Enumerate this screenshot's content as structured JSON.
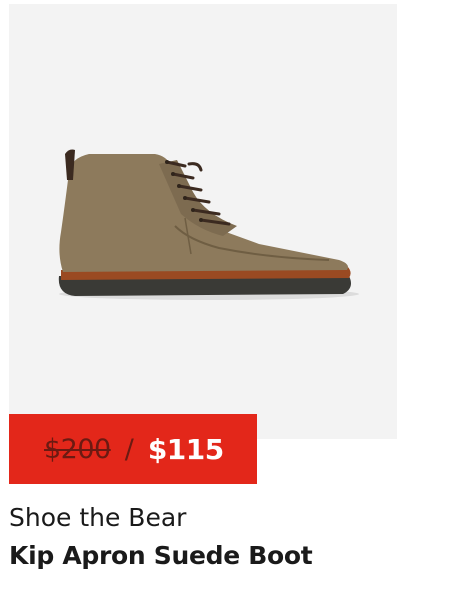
{
  "product": {
    "image_alt": "Kip Apron Suede Boot",
    "price": {
      "original": "$200",
      "separator": "/",
      "sale": "$115",
      "badge_color": "#e3271a"
    },
    "brand": "Shoe the Bear",
    "name": "Kip Apron Suede Boot"
  }
}
